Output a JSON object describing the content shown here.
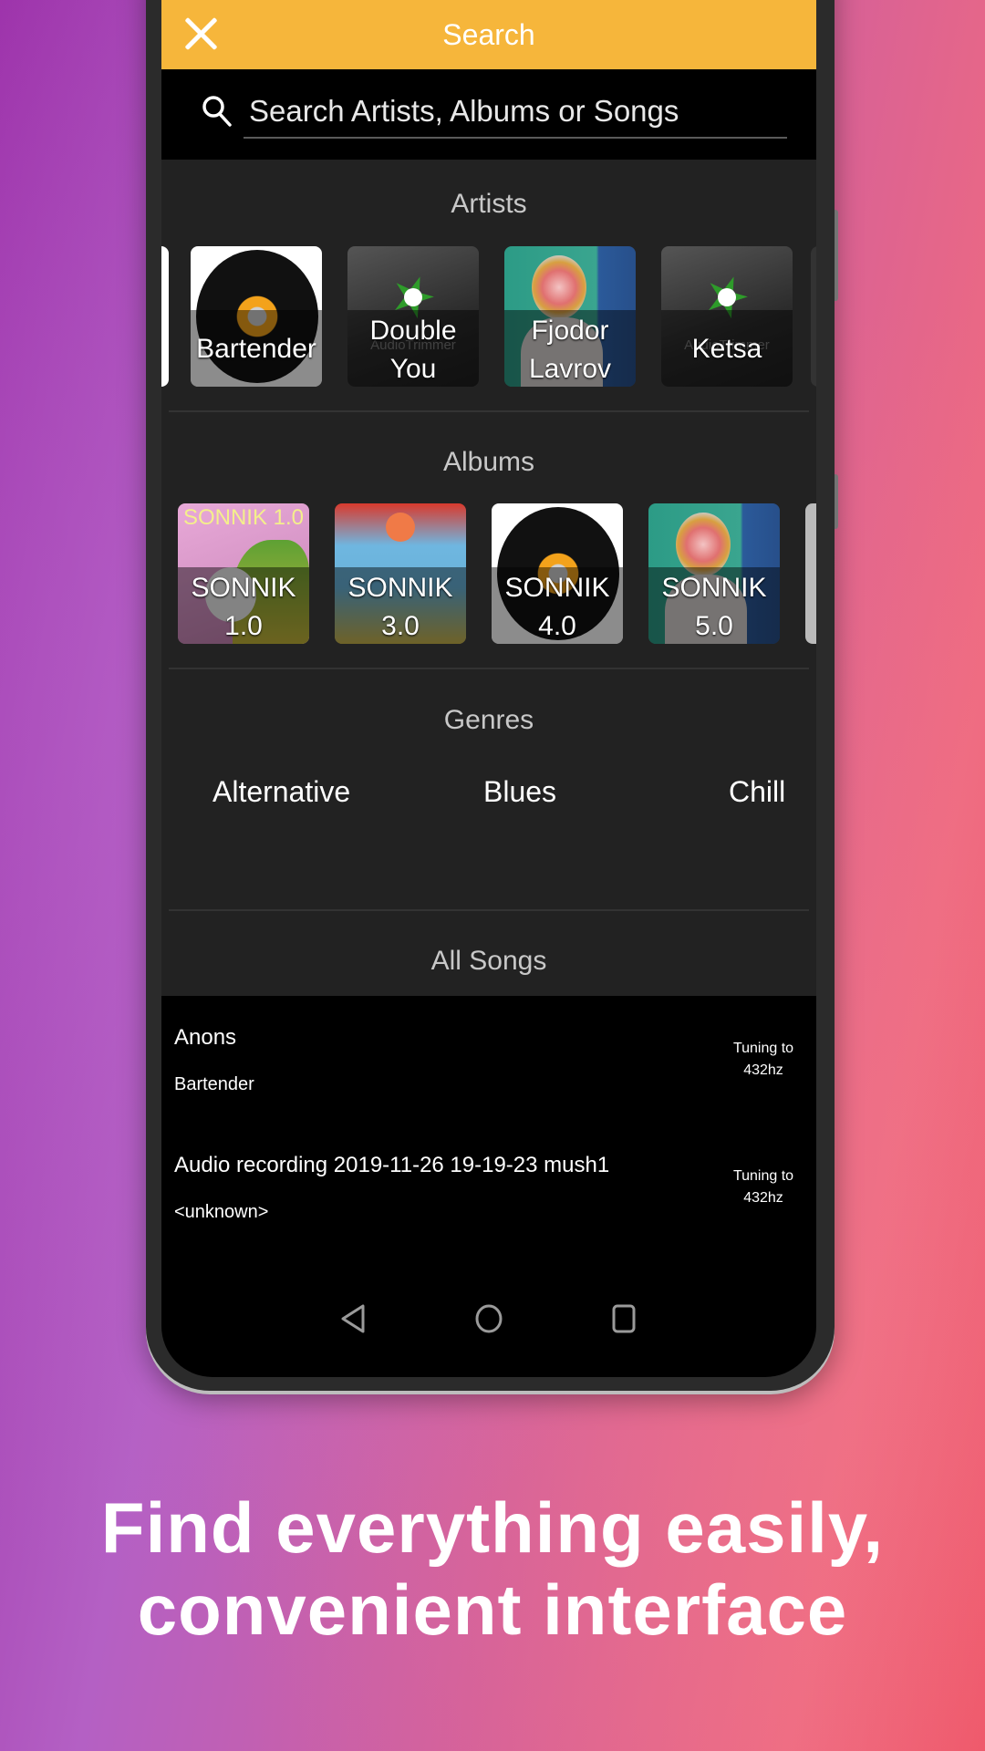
{
  "header": {
    "title": "Search",
    "close_icon": "close-icon"
  },
  "search": {
    "placeholder": "Search Artists, Albums or Songs",
    "value": "",
    "icon": "search-icon"
  },
  "artists": {
    "title": "Artists",
    "items": [
      {
        "name": "Bartender",
        "art": "vinyl-record"
      },
      {
        "name": "Double You",
        "art": "audiotrimmer-logo",
        "watermark": "AudioTrimmer"
      },
      {
        "name": "Fjodor Lavrov",
        "art": "teal-portrait"
      },
      {
        "name": "Ketsa",
        "art": "audiotrimmer-logo",
        "watermark": "AudioTrimmer"
      }
    ]
  },
  "albums": {
    "title": "Albums",
    "items": [
      {
        "name": "SONNIK 1.0",
        "art": "parrot",
        "art_text": "SONNIK 1.0"
      },
      {
        "name": "SONNIK 3.0",
        "art": "folk-painting"
      },
      {
        "name": "SONNIK 4.0",
        "art": "vinyl-record"
      },
      {
        "name": "SONNIK 5.0",
        "art": "teal-portrait"
      }
    ]
  },
  "genres": {
    "title": "Genres",
    "items": [
      "Alternative",
      "Blues",
      "Chill"
    ]
  },
  "songs": {
    "title": "All Songs",
    "items": [
      {
        "title": "Anons",
        "artist": "Bartender",
        "tag_line1": "Tuning to",
        "tag_line2": "432hz"
      },
      {
        "title": "Audio recording 2019-11-26 19-19-23 mush1",
        "artist": "<unknown>",
        "tag_line1": "Tuning to",
        "tag_line2": "432hz"
      }
    ]
  },
  "navbar": {
    "back": "back-icon",
    "home": "home-icon",
    "recents": "recents-icon"
  },
  "caption": {
    "line1": "Find everything easily,",
    "line2": "convenient interface"
  },
  "colors": {
    "accent": "#f6b63b",
    "content_bg": "#222222",
    "list_bg": "#000000"
  }
}
